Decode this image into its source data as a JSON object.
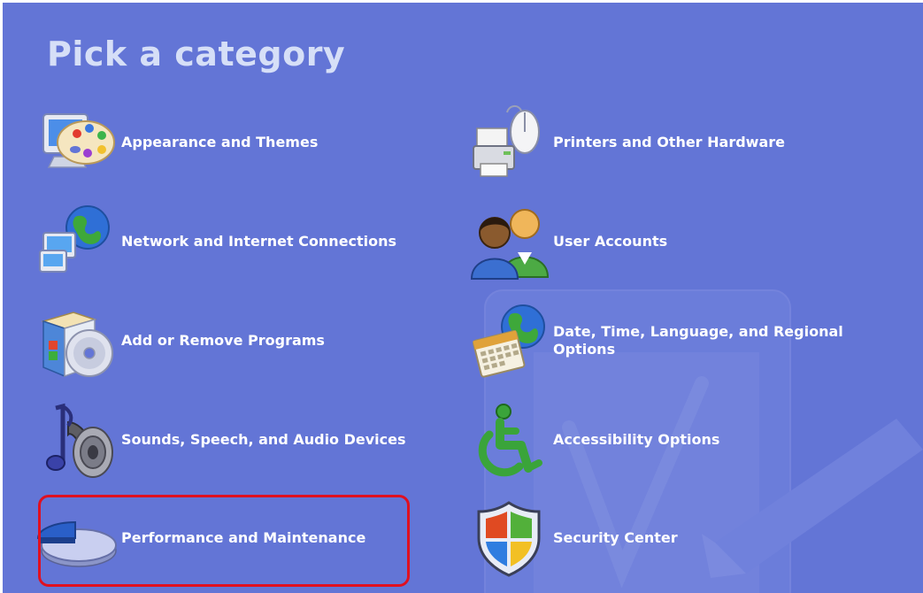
{
  "header": {
    "title": "Pick a category"
  },
  "categories": [
    {
      "label": "Appearance and Themes",
      "icon": "appearance-themes-icon"
    },
    {
      "label": "Printers and Other Hardware",
      "icon": "printer-hardware-icon"
    },
    {
      "label": "Network and Internet Connections",
      "icon": "network-globe-icon"
    },
    {
      "label": "User Accounts",
      "icon": "user-accounts-icon"
    },
    {
      "label": "Add or Remove Programs",
      "icon": "add-remove-programs-icon"
    },
    {
      "label": "Date, Time, Language, and Regional Options",
      "icon": "date-time-globe-icon"
    },
    {
      "label": "Sounds, Speech, and Audio Devices",
      "icon": "sounds-audio-icon"
    },
    {
      "label": "Accessibility Options",
      "icon": "accessibility-icon"
    },
    {
      "label": "Performance and Maintenance",
      "icon": "performance-pie-icon"
    },
    {
      "label": "Security Center",
      "icon": "security-shield-icon"
    }
  ],
  "highlight": {
    "target": "Performance and Maintenance",
    "color": "#e01020"
  },
  "colors": {
    "panel_background": "#6375d6",
    "title": "#d6dff7",
    "label": "#ffffff"
  }
}
